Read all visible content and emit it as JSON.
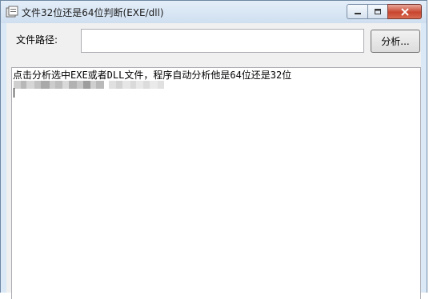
{
  "window": {
    "title": "文件32位还是64位判断(EXE/dll)",
    "icons": {
      "app": "app-icon",
      "minimize": "minimize-icon",
      "maximize": "maximize-icon",
      "close": "close-icon"
    }
  },
  "form": {
    "path_label": "文件路径:",
    "path_value": "",
    "analyze_button": "分析..."
  },
  "output": {
    "instruction": "点击分析选中EXE或者DLL文件，程序自动分析他是64位还是32位"
  },
  "colors": {
    "titlebar": "#dbe8f6",
    "client_bg": "#f0f0f0",
    "close_button": "#c8452e"
  }
}
